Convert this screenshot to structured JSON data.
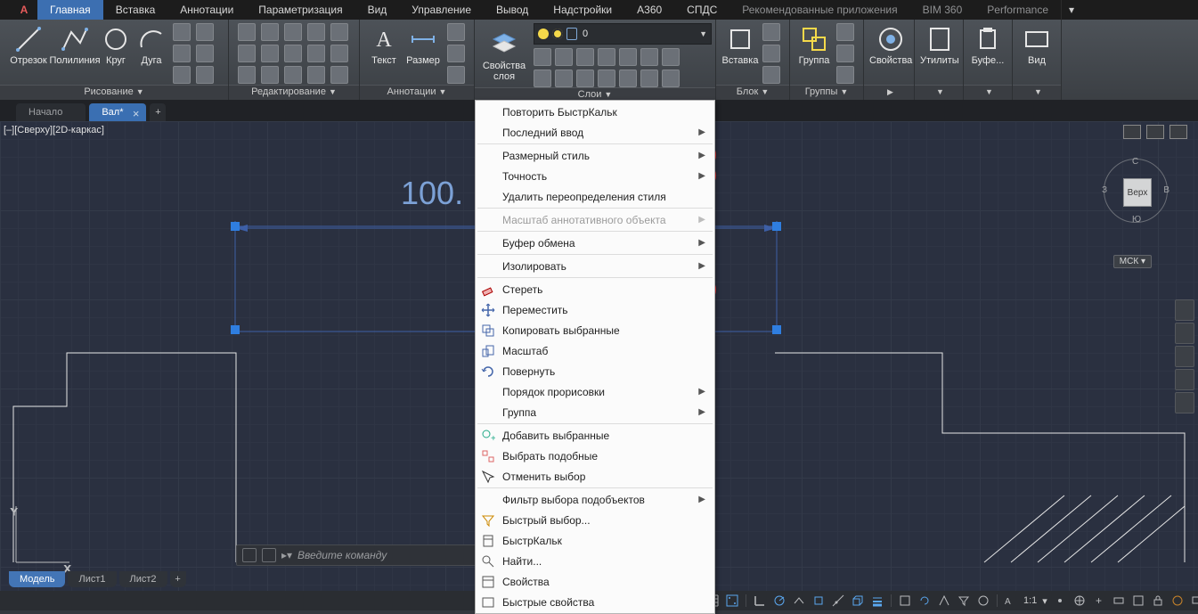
{
  "ribbonTabs": [
    "Главная",
    "Вставка",
    "Аннотации",
    "Параметризация",
    "Вид",
    "Управление",
    "Вывод",
    "Надстройки",
    "A360",
    "СПДС",
    "Рекомендованные приложения",
    "BIM 360",
    "Performance"
  ],
  "panels": {
    "draw": {
      "title": "Рисование",
      "b1": "Отрезок",
      "b2": "Полилиния",
      "b3": "Круг",
      "b4": "Дуга"
    },
    "modify": {
      "title": "Редактирование"
    },
    "annot": {
      "title": "Аннотации",
      "b1": "Текст",
      "b2": "Размер"
    },
    "layers": {
      "title": "Слои",
      "b1": "Свойства\nслоя",
      "current": "0"
    },
    "block": {
      "title": "Блок",
      "b1": "Вставка"
    },
    "groups": {
      "title": "Группы",
      "b1": "Группа"
    },
    "props": {
      "title": "",
      "b1": "Свойства"
    },
    "util": {
      "title": "",
      "b1": "Утилиты"
    },
    "clip": {
      "title": "",
      "b1": "Буфе..."
    },
    "view": {
      "title": "",
      "b1": "Вид"
    }
  },
  "docTabs": {
    "home": "Начало",
    "active": "Вал*",
    "add": "+"
  },
  "viewLabel": "[–][Сверху][2D-каркас]",
  "dimValue": "100.",
  "viewcube": {
    "top": "Верх",
    "n": "С",
    "s": "Ю",
    "e": "В",
    "w": "З",
    "wcs": "МСК"
  },
  "commandLine": {
    "placeholder": "Введите команду"
  },
  "modelTabs": {
    "model": "Модель",
    "l1": "Лист1",
    "l2": "Лист2",
    "add": "+"
  },
  "statusScale": "1:1",
  "ctx": {
    "repeat": "Повторить БыстрКальк",
    "last": "Последний ввод",
    "dimstyle": "Размерный стиль",
    "prec": "Точность",
    "delover": "Удалить переопределения стиля",
    "annoscale": "Масштаб аннотативного объекта",
    "clip": "Буфер обмена",
    "iso": "Изолировать",
    "erase": "Стереть",
    "move": "Переместить",
    "copy": "Копировать выбранные",
    "scale": "Масштаб",
    "rotate": "Повернуть",
    "draworder": "Порядок прорисовки",
    "group": "Группа",
    "addsel": "Добавить выбранные",
    "selsim": "Выбрать подобные",
    "desel": "Отменить выбор",
    "subfilter": "Фильтр выбора подобъектов",
    "qsel": "Быстрый выбор...",
    "qcalc": "БыстрКальк",
    "find": "Найти...",
    "props": "Свойства",
    "qprops": "Быстрые свойства"
  }
}
